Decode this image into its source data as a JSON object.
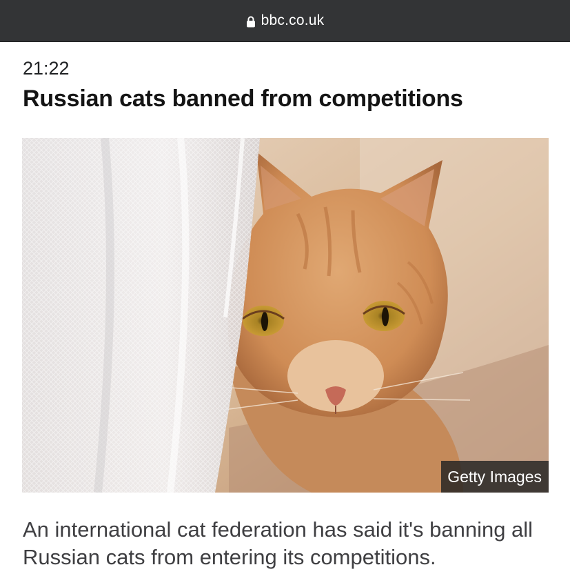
{
  "browser": {
    "url": "bbc.co.uk",
    "lock_icon": "lock-icon"
  },
  "article": {
    "time": "21:22",
    "headline": "Russian cats banned from competitions",
    "image": {
      "subject": "cat-photo",
      "credit": "Getty Images"
    },
    "summary": "An international cat federation has said it's banning all Russian cats from entering its competitions."
  },
  "colors": {
    "url_bar_bg": "#333436",
    "headline": "#141414",
    "body_text": "#3f3f42",
    "credit_bg": "#222222"
  }
}
